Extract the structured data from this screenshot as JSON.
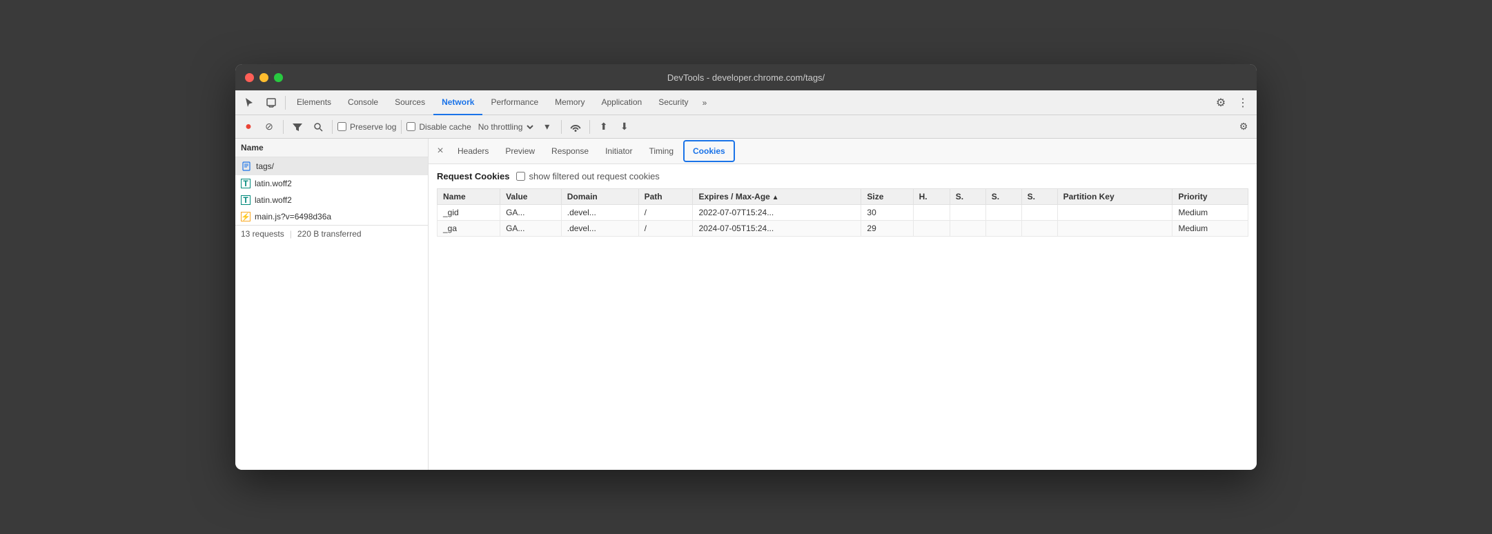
{
  "window": {
    "title": "DevTools - developer.chrome.com/tags/"
  },
  "titlebar": {
    "close": "×",
    "minimize": "−",
    "maximize": "+"
  },
  "devtools_tabs": {
    "items": [
      {
        "label": "Elements",
        "active": false
      },
      {
        "label": "Console",
        "active": false
      },
      {
        "label": "Sources",
        "active": false
      },
      {
        "label": "Network",
        "active": true
      },
      {
        "label": "Performance",
        "active": false
      },
      {
        "label": "Memory",
        "active": false
      },
      {
        "label": "Application",
        "active": false
      },
      {
        "label": "Security",
        "active": false
      }
    ],
    "more": "»",
    "gear_icon": "⚙",
    "more_vert_icon": "⋮"
  },
  "toolbar": {
    "record_label": "●",
    "block_label": "⊘",
    "filter_label": "⏼",
    "search_label": "🔍",
    "preserve_log": "Preserve log",
    "disable_cache": "Disable cache",
    "throttling": "No throttling",
    "wifi_icon": "📶",
    "upload_icon": "⬆",
    "download_icon": "⬇",
    "gear_icon": "⚙"
  },
  "sidebar": {
    "header": "Name",
    "items": [
      {
        "label": "tags/",
        "icon": "doc",
        "icon_color": "blue",
        "selected": true
      },
      {
        "label": "latin.woff2",
        "icon": "T",
        "icon_color": "teal",
        "selected": false
      },
      {
        "label": "latin.woff2",
        "icon": "T",
        "icon_color": "teal",
        "selected": false
      },
      {
        "label": "main.js?v=6498d36a",
        "icon": "⚡",
        "icon_color": "yellow",
        "selected": false
      }
    ],
    "status": {
      "requests": "13 requests",
      "separator": "|",
      "transferred": "220 B transferred"
    }
  },
  "detail_tabs": {
    "close_icon": "×",
    "items": [
      {
        "label": "Headers",
        "active": false
      },
      {
        "label": "Preview",
        "active": false
      },
      {
        "label": "Response",
        "active": false
      },
      {
        "label": "Initiator",
        "active": false
      },
      {
        "label": "Timing",
        "active": false
      },
      {
        "label": "Cookies",
        "active": true,
        "outlined": true
      }
    ]
  },
  "cookies": {
    "title": "Request Cookies",
    "show_filtered_label": "show filtered out request cookies",
    "table": {
      "headers": [
        {
          "label": "Name",
          "sortable": false
        },
        {
          "label": "Value",
          "sortable": false
        },
        {
          "label": "Domain",
          "sortable": false
        },
        {
          "label": "Path",
          "sortable": false
        },
        {
          "label": "Expires / Max-Age",
          "sortable": true,
          "sort_dir": "asc"
        },
        {
          "label": "Size",
          "sortable": false
        },
        {
          "label": "H.",
          "sortable": false
        },
        {
          "label": "S.",
          "sortable": false
        },
        {
          "label": "S.",
          "sortable": false
        },
        {
          "label": "S.",
          "sortable": false
        },
        {
          "label": "Partition Key",
          "sortable": false
        },
        {
          "label": "Priority",
          "sortable": false
        }
      ],
      "rows": [
        {
          "name": "_gid",
          "value": "GA...",
          "domain": ".devel...",
          "path": "/",
          "expires": "2022-07-07T15:24...",
          "size": "30",
          "h": "",
          "s1": "",
          "s2": "",
          "s3": "",
          "partition_key": "",
          "priority": "Medium"
        },
        {
          "name": "_ga",
          "value": "GA...",
          "domain": ".devel...",
          "path": "/",
          "expires": "2024-07-05T15:24...",
          "size": "29",
          "h": "",
          "s1": "",
          "s2": "",
          "s3": "",
          "partition_key": "",
          "priority": "Medium"
        }
      ]
    }
  }
}
